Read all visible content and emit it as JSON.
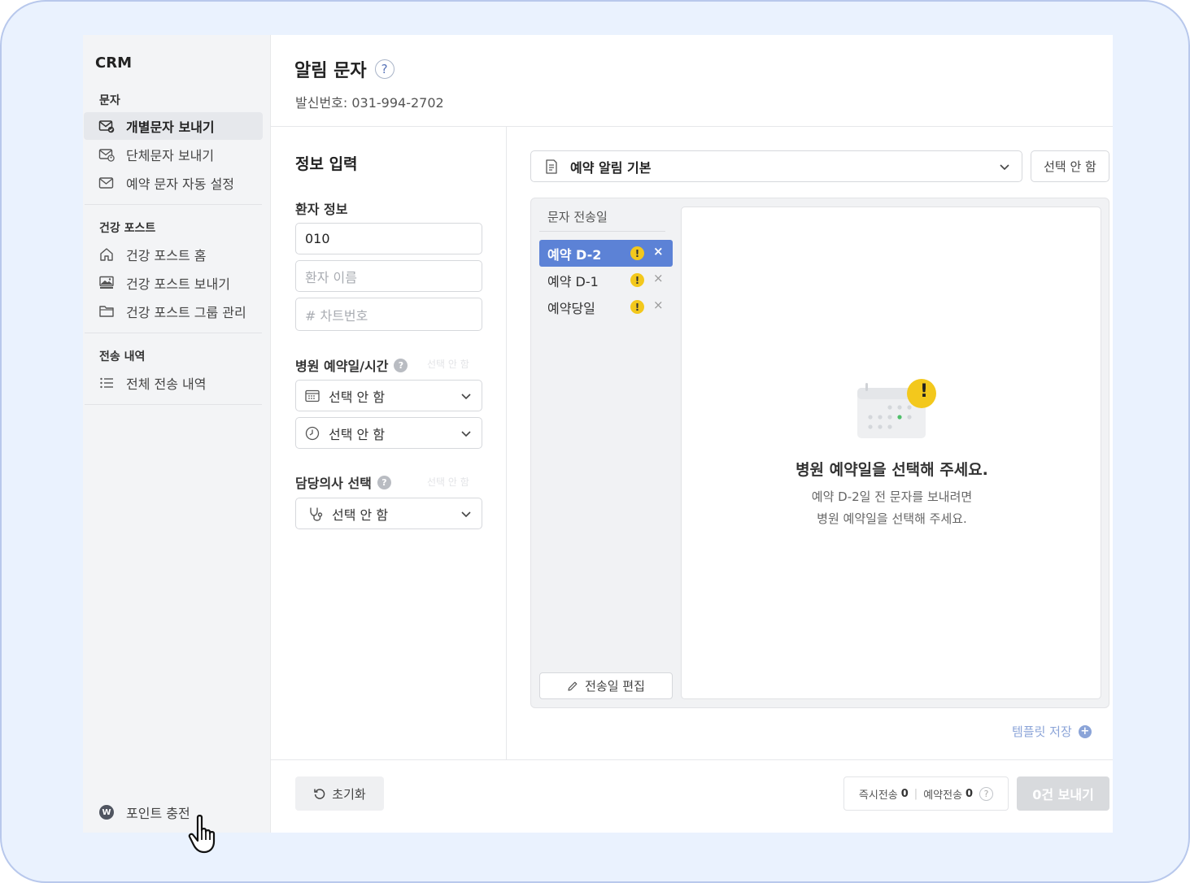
{
  "sidebar": {
    "brand": "CRM",
    "sections": [
      {
        "title": "문자",
        "items": [
          {
            "label": "개별문자 보내기",
            "icon": "envelope-check-icon",
            "active": true
          },
          {
            "label": "단체문자 보내기",
            "icon": "envelope-group-icon",
            "active": false
          },
          {
            "label": "예약 문자 자동 설정",
            "icon": "envelope-icon",
            "active": false
          }
        ]
      },
      {
        "title": "건강 포스트",
        "items": [
          {
            "label": "건강 포스트 홈",
            "icon": "home-icon"
          },
          {
            "label": "건강 포스트 보내기",
            "icon": "image-post-icon"
          },
          {
            "label": "건강 포스트 그룹 관리",
            "icon": "folder-icon"
          }
        ]
      },
      {
        "title": "전송 내역",
        "items": [
          {
            "label": "전체 전송 내역",
            "icon": "list-icon"
          }
        ]
      }
    ],
    "point_label": "포인트 충전",
    "point_icon": "coin-icon",
    "point_coin_text": "W"
  },
  "header": {
    "title": "알림 문자",
    "help": "?",
    "sender": "발신번호: 031-994-2702"
  },
  "form": {
    "title": "정보 입력",
    "patient_label": "환자 정보",
    "phone_value": "010",
    "name_placeholder": "환자 이름",
    "chart_placeholder": "#  차트번호",
    "appt_label": "병원 예약일/시간",
    "appt_hint": "선택 안 함",
    "date_select": "선택 안 함",
    "time_select": "선택 안 함",
    "doctor_label": "담당의사 선택",
    "doctor_hint": "선택 안 함",
    "doctor_select": "선택 안 함",
    "qmark": "?"
  },
  "template": {
    "selected": "예약 알림 기본",
    "none_button": "선택 안 함"
  },
  "schedule": {
    "header": "문자 전송일",
    "days": [
      {
        "label": "예약 D-2",
        "active": true
      },
      {
        "label": "예약 D-1",
        "active": false
      },
      {
        "label": "예약당일",
        "active": false
      }
    ],
    "warn_mark": "!",
    "remove_mark": "×",
    "edit_button": "전송일 편집"
  },
  "preview": {
    "empty_title": "병원 예약일을 선택해 주세요.",
    "empty_desc_1": "예약 D-2일 전 문자를 보내려면",
    "empty_desc_2": "병원 예약일을 선택해 주세요.",
    "warn_mark": "!"
  },
  "save_template": "템플릿 저장",
  "footer": {
    "reset": "초기화",
    "instant_label": "즉시전송",
    "instant_count": "0",
    "scheduled_label": "예약전송",
    "scheduled_count": "0",
    "send_button": "0건 보내기"
  },
  "colors": {
    "accent": "#5c82d6",
    "warning": "#f3c81c",
    "frame": "#eaf2fe"
  }
}
